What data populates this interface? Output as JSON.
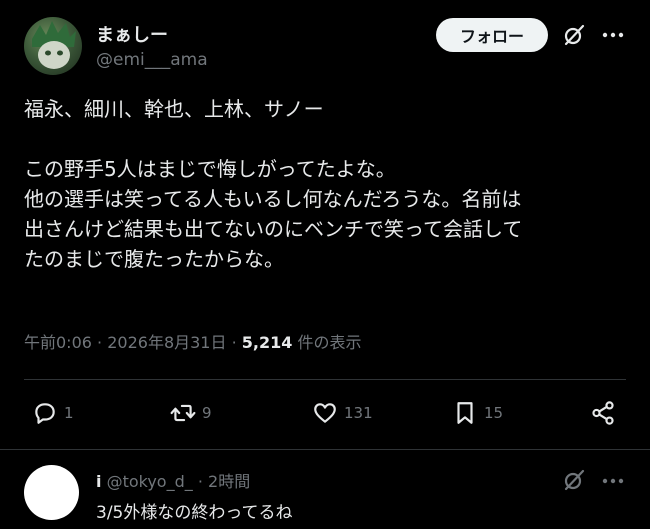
{
  "post": {
    "author_name": "まぁしー",
    "author_handle": "@emi___ama",
    "follow_label": "フォロー",
    "text": "福永、細川、幹也、上林、サノー\n\nこの野手5人はまじで悔しがってたよな。\n他の選手は笑ってる人もいるし何なんだろうな。名前は\n出さんけど結果も出てないのにベンチで笑って会話して\nたのまじで腹たったからな。",
    "time": "午前0:06",
    "date": "2026年8月31日",
    "views": "5,214",
    "views_label": "件の表示",
    "separator": "·"
  },
  "actions": {
    "replies": "1",
    "reposts": "9",
    "likes": "131",
    "bookmarks": "15"
  },
  "reply": {
    "name": "i",
    "handle": "@tokyo_d_",
    "separator": "·",
    "time": "2時間",
    "text": "3/5外様なの終わってるね"
  },
  "colors": {
    "background": "#000000",
    "text": "#e7e9ea",
    "muted": "#71767b",
    "divider": "#2f3336",
    "follow_bg": "#eff3f4"
  }
}
